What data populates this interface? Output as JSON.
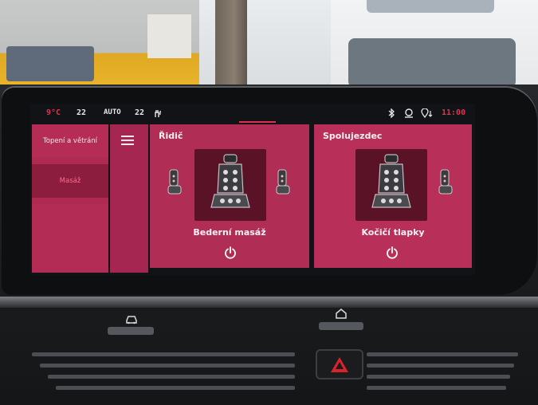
{
  "status_bar": {
    "outside_temp": "9°C",
    "left_temp": "22",
    "climate_mode": "AUTO",
    "right_temp": "22",
    "time": "11:00",
    "icons": [
      "seat-heat-icon",
      "bluetooth-icon",
      "driver-profile-icon",
      "location-icon"
    ]
  },
  "sidebar": {
    "items": [
      {
        "label": "Topení a větrání",
        "selected": false
      },
      {
        "label": "Masáž",
        "selected": true
      }
    ]
  },
  "panels": [
    {
      "title": "Řidič",
      "program": "Bederní masáž",
      "icon": "power-icon"
    },
    {
      "title": "Spolujezdec",
      "program": "Kočičí tlapky",
      "icon": "power-icon"
    }
  ],
  "colors": {
    "accent": "#e2314d",
    "panel": "#b02d55",
    "selected_item": "#8c1d3e",
    "seat_box": "#5a1226"
  }
}
